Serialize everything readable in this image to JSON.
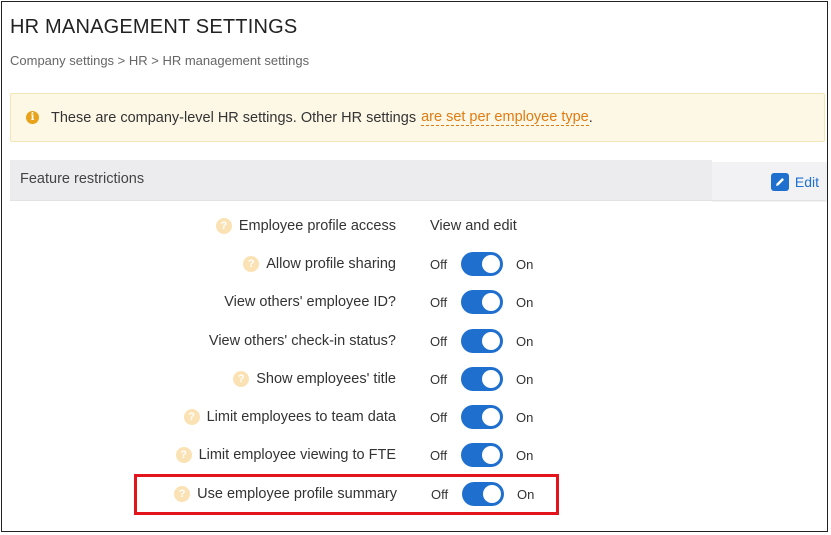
{
  "header": {
    "title": "HR MANAGEMENT SETTINGS",
    "breadcrumb": "Company settings > HR > HR management settings"
  },
  "banner": {
    "text": "These are company-level HR settings. Other HR settings",
    "link": "are set per employee type",
    "suffix": ".",
    "icon": "info-icon"
  },
  "section": {
    "title": "Feature restrictions",
    "edit_label": "Edit"
  },
  "settings": [
    {
      "label": "Employee profile access",
      "help": true,
      "value": "View and edit"
    },
    {
      "label": "Allow profile sharing",
      "help": true,
      "off": "Off",
      "on": "On",
      "state": "on"
    },
    {
      "label": "View others' employee ID?",
      "help": false,
      "off": "Off",
      "on": "On",
      "state": "on"
    },
    {
      "label": "View others' check-in status?",
      "help": false,
      "off": "Off",
      "on": "On",
      "state": "on"
    },
    {
      "label": "Show employees' title",
      "help": true,
      "off": "Off",
      "on": "On",
      "state": "on"
    },
    {
      "label": "Limit employees to team data",
      "help": true,
      "off": "Off",
      "on": "On",
      "state": "on"
    },
    {
      "label": "Limit employee viewing to FTE",
      "help": true,
      "off": "Off",
      "on": "On",
      "state": "on"
    },
    {
      "label": "Use employee profile summary",
      "help": true,
      "off": "Off",
      "on": "On",
      "state": "on",
      "highlighted": true
    }
  ],
  "colors": {
    "accent": "#1f6fcf",
    "link": "#e07b12",
    "highlight": "#e3141b",
    "banner_bg": "#fdf8e6"
  }
}
